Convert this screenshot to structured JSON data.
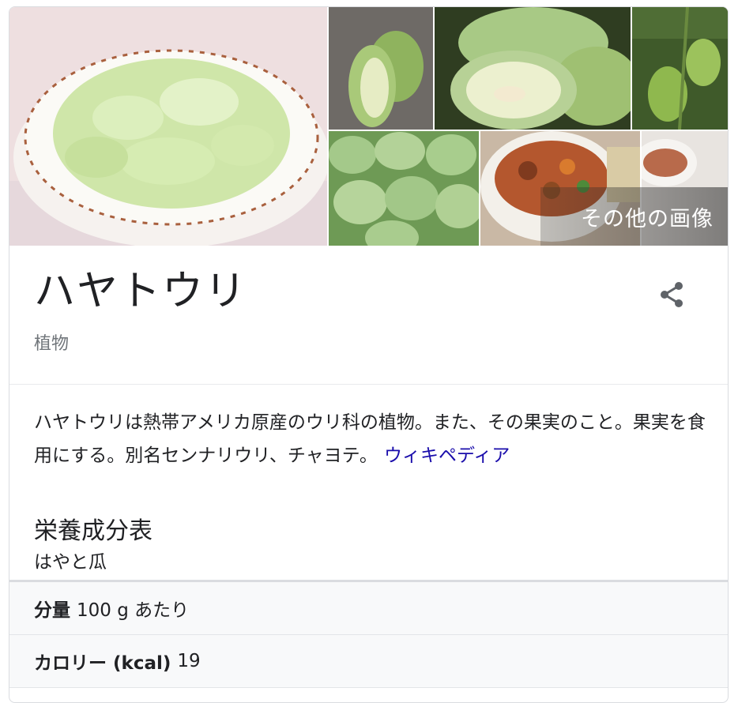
{
  "images": {
    "more_label": "その他の画像"
  },
  "entity": {
    "title": "ハヤトウリ",
    "subtitle": "植物"
  },
  "description": {
    "text": "ハヤトウリは熱帯アメリカ原産のウリ科の植物。また、その果実のこと。果実を食用にする。別名センナリウリ、チャヨテ。",
    "source_link": "ウィキペディア"
  },
  "nutrition": {
    "title": "栄養成分表",
    "subtitle": "はやと瓜",
    "rows": [
      {
        "label": "分量",
        "value": "100 g あたり"
      },
      {
        "label": "カロリー (kcal)",
        "value": "19"
      }
    ]
  },
  "colors": {
    "link": "#1a0dab",
    "text": "#202124",
    "muted": "#70757a",
    "table_bg": "#f8f9fa"
  },
  "icons": {
    "share": "share-icon"
  }
}
